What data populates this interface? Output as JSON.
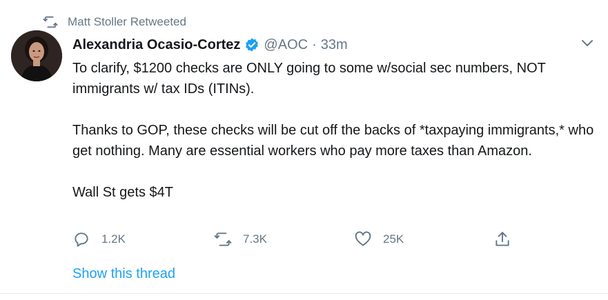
{
  "retweet": {
    "icon": "retweet-icon",
    "text": "Matt Stoller Retweeted"
  },
  "author": {
    "name": "Alexandria Ocasio-Cortez",
    "verified": true,
    "handle": "@AOC",
    "separator": "·",
    "time": "33m"
  },
  "tweet": {
    "paragraphs": [
      "To clarify, $1200 checks are ONLY going to some w/social sec numbers, NOT immigrants w/ tax IDs (ITINs).",
      "Thanks to GOP, these checks will be cut off the backs of *taxpaying immigrants,* who get nothing. Many are essential workers who pay more taxes than Amazon.",
      "Wall St gets $4T"
    ]
  },
  "actions": {
    "reply": {
      "icon": "reply-icon",
      "count": "1.2K"
    },
    "retweet": {
      "icon": "retweet-icon",
      "count": "7.3K"
    },
    "like": {
      "icon": "heart-icon",
      "count": "25K"
    },
    "share": {
      "icon": "share-icon"
    }
  },
  "show_thread": "Show this thread",
  "colors": {
    "text": "#14171a",
    "muted": "#657786",
    "link": "#1da1f2",
    "verified": "#1da1f2"
  }
}
